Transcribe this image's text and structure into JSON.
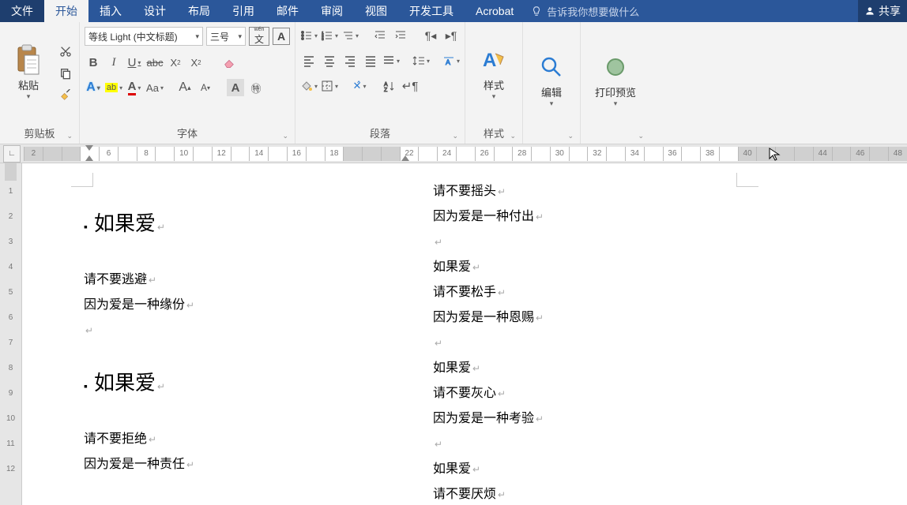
{
  "tabs": {
    "file": "文件",
    "home": "开始",
    "insert": "插入",
    "design": "设计",
    "layout": "布局",
    "references": "引用",
    "mail": "邮件",
    "review": "审阅",
    "view": "视图",
    "devtools": "开发工具",
    "acrobat": "Acrobat"
  },
  "tellme": "告诉我你想要做什么",
  "share": "共享",
  "clipboard": {
    "paste": "粘贴",
    "label": "剪贴板"
  },
  "font": {
    "name": "等线 Light (中文标题)",
    "size": "三号",
    "label": "字体",
    "wen": "文",
    "bold": "B",
    "italic": "I",
    "underline": "U",
    "A": "A",
    "Aa": "Aa",
    "abc": "abc"
  },
  "paragraph": {
    "label": "段落"
  },
  "styles": {
    "title": "样式",
    "label": "样式"
  },
  "editing": {
    "title": "编辑"
  },
  "preview": {
    "title": "打印预览"
  },
  "ruler": {
    "marks": [
      "2",
      "",
      "",
      "",
      "6",
      "",
      "8",
      "",
      "10",
      "",
      "12",
      "",
      "14",
      "",
      "16",
      "",
      "18",
      "",
      "",
      "",
      "22",
      "",
      "24",
      "",
      "26",
      "",
      "28",
      "",
      "30",
      "",
      "32",
      "",
      "34",
      "",
      "36",
      "",
      "38",
      "",
      "40",
      "",
      "",
      "",
      "44",
      "",
      "46",
      "",
      "48"
    ]
  },
  "vruler": {
    "marks": [
      "1",
      "2",
      "3",
      "4",
      "5",
      "6",
      "7",
      "8",
      "9",
      "10",
      "11",
      "12"
    ]
  },
  "doc": {
    "left": {
      "h1": "如果爱",
      "p1": "请不要逃避",
      "p2": "因为爱是一种缘份",
      "h2": "如果爱",
      "p3": "请不要拒绝",
      "p4": "因为爱是一种责任"
    },
    "right": {
      "p1": "请不要摇头",
      "p2": "因为爱是一种付出",
      "h1": "如果爱",
      "p3": "请不要松手",
      "p4": "因为爱是一种恩赐",
      "h2": "如果爱",
      "p5": "请不要灰心",
      "p6": "因为爱是一种考验",
      "h3": "如果爱",
      "p7": "请不要厌烦"
    }
  }
}
